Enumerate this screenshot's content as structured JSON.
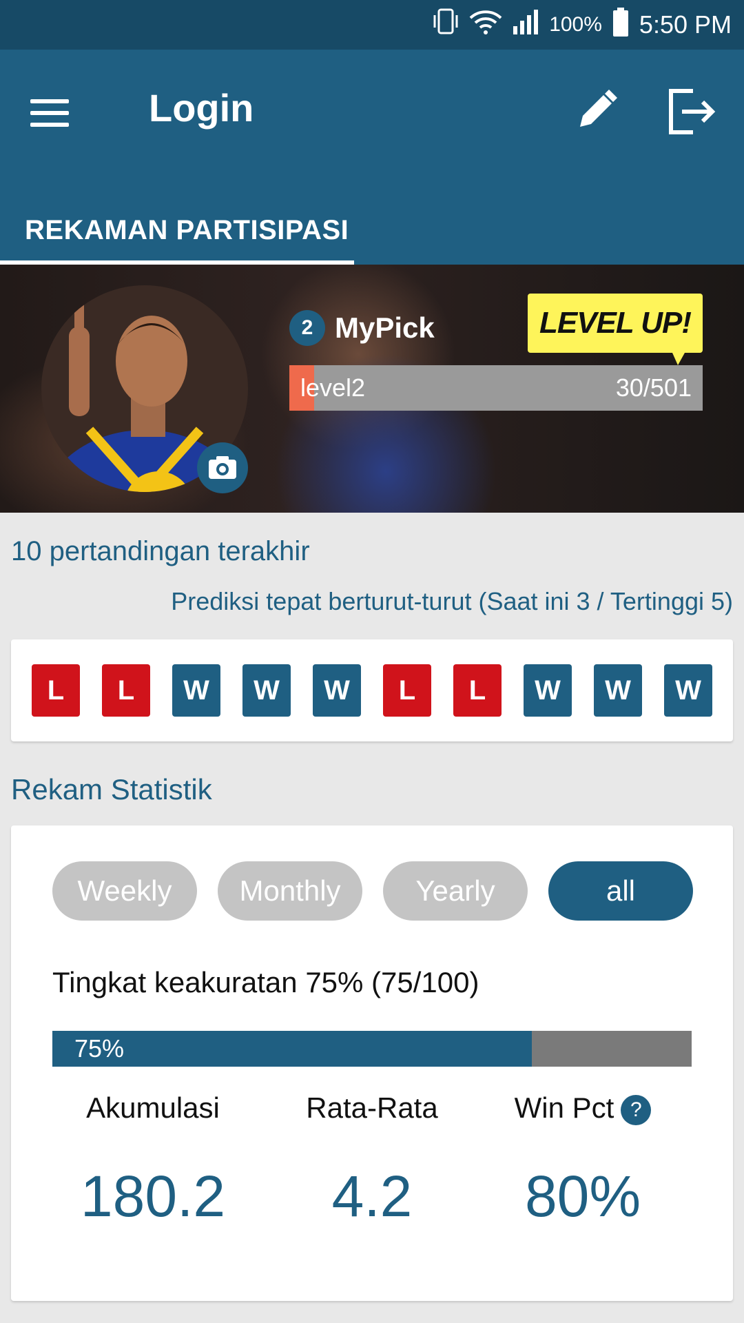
{
  "status_bar": {
    "battery_pct": "100%",
    "time": "5:50 PM",
    "icons": [
      "vibrate-icon",
      "wifi-icon",
      "signal-icon",
      "battery-icon"
    ]
  },
  "app_bar": {
    "title": "Login",
    "menu_icon": "hamburger-menu-icon",
    "edit_icon": "pencil-icon",
    "logout_icon": "logout-icon"
  },
  "tabs": [
    {
      "label": "REKAMAN PARTISIPASI",
      "active": true
    }
  ],
  "profile": {
    "level_number": "2",
    "username": "MyPick",
    "level_up_banner": "LEVEL UP!",
    "level_name": "level2",
    "level_score": "30/501",
    "level_progress": 0.06,
    "camera_icon": "camera-icon"
  },
  "recent": {
    "title": "10 pertandingan terakhir",
    "streak_text": "Prediksi tepat berturut-turut (Saat ini 3 / Tertinggi 5)",
    "results": [
      "L",
      "L",
      "W",
      "W",
      "W",
      "L",
      "L",
      "W",
      "W",
      "W"
    ]
  },
  "stats": {
    "title": "Rekam Statistik",
    "periods": [
      "Weekly",
      "Monthly",
      "Yearly",
      "all"
    ],
    "active_period": "all",
    "accuracy_label": "Tingkat keakuratan 75% (75/100)",
    "accuracy_pct": 75,
    "accuracy_text": "75%",
    "metrics": [
      {
        "label": "Akumulasi",
        "value": "180.2"
      },
      {
        "label": "Rata-Rata",
        "value": "4.2"
      },
      {
        "label": "Win Pct",
        "value": "80%",
        "help_icon": "question-icon"
      }
    ]
  },
  "colors": {
    "primary": "#1f5f82",
    "status_bar": "#174a66",
    "loss": "#d0131b",
    "level_up_yellow": "#fef45a",
    "level_fill": "#ef6a4c"
  }
}
